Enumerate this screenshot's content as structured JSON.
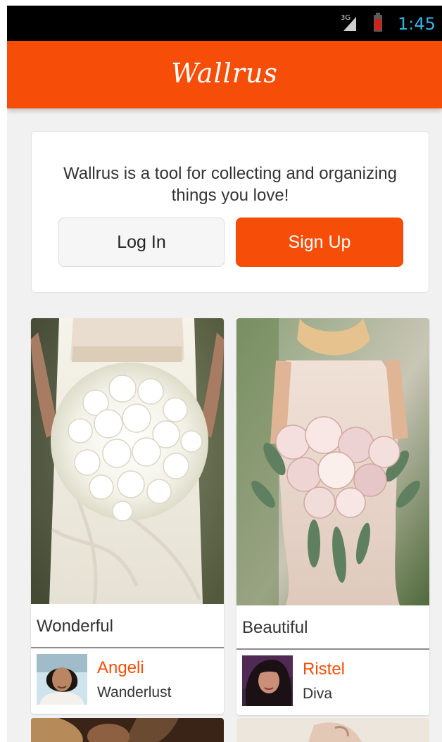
{
  "status_bar": {
    "network": "3G",
    "time": "1:45",
    "time_color": "#33b5e5"
  },
  "app_bar": {
    "title": "Wallrus",
    "color": "#f64e08"
  },
  "intro": {
    "text": "Wallrus is a tool for collecting and organizing things you love!",
    "login_label": "Log In",
    "signup_label": "Sign Up"
  },
  "pins": [
    {
      "caption": "Wonderful",
      "user_name": "Angeli",
      "board": "Wanderlust",
      "image": "white-rose-bridal-bouquet"
    },
    {
      "caption": "Beautiful",
      "user_name": "Ristel",
      "board": "Diva",
      "image": "blush-rose-bridal-bouquet"
    }
  ],
  "accent_color": "#f64e08"
}
